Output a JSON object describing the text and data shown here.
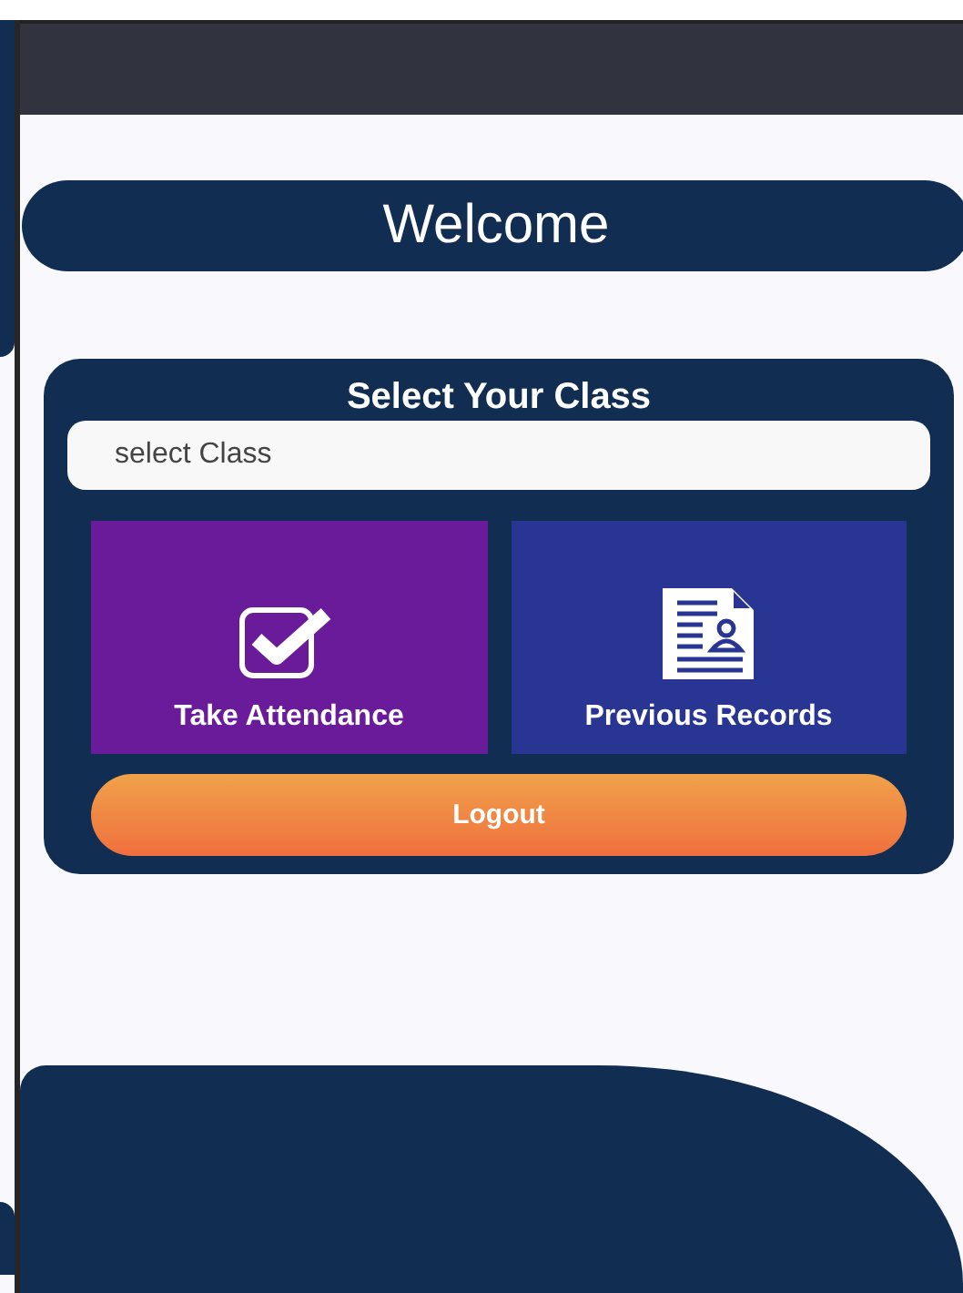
{
  "header": {
    "title": "Welcome"
  },
  "class_card": {
    "title": "Select Your Class",
    "class_field": {
      "placeholder": "select Class"
    },
    "tiles": [
      {
        "kind": "attendance",
        "label": "Take Attendance",
        "color": "#6a1b9a"
      },
      {
        "kind": "records",
        "label": "Previous Records",
        "color": "#283593"
      }
    ],
    "logout": "Logout"
  }
}
